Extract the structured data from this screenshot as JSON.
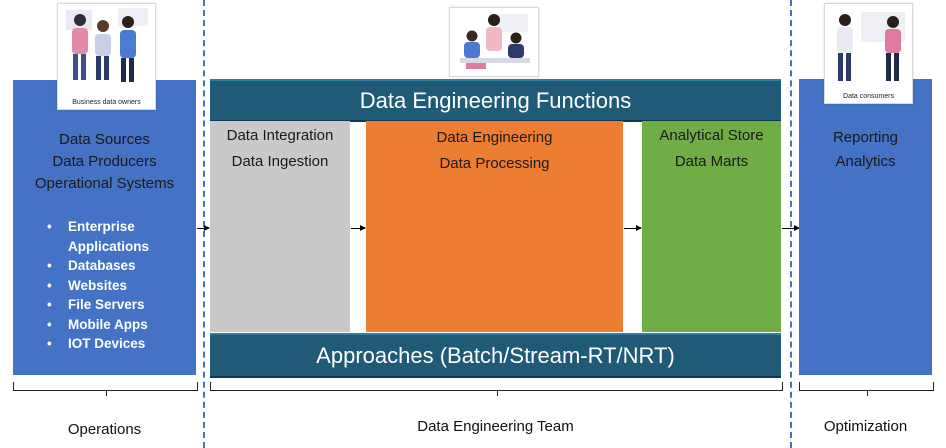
{
  "left_panel": {
    "titles": [
      "Data Sources",
      "Data Producers",
      "Operational Systems"
    ],
    "items": [
      [
        "Enterprise",
        "Applications"
      ],
      [
        "Databases"
      ],
      [
        "Websites"
      ],
      [
        "File Servers"
      ],
      [
        "Mobile Apps"
      ],
      [
        "IOT Devices"
      ]
    ]
  },
  "images": {
    "left_caption": "Business data owners",
    "right_caption": "Data consumers"
  },
  "center": {
    "header": "Data Engineering Functions",
    "footer": "Approaches (Batch/Stream-RT/NRT)",
    "stages": [
      {
        "line1": "Data Integration",
        "line2": "Data Ingestion",
        "color": "#c9c9c9"
      },
      {
        "line1": "Data Engineering",
        "line2": "Data Processing",
        "color": "#ed7d31"
      },
      {
        "line1": "Analytical Store",
        "line2": "Data Marts",
        "color": "#70ad47"
      }
    ]
  },
  "right_panel": {
    "titles": [
      "Reporting",
      "Analytics"
    ]
  },
  "footers": {
    "left": "Operations",
    "center": "Data Engineering Team",
    "right": "Optimization"
  },
  "colors": {
    "panel_blue": "#4472c4",
    "banner_teal": "#1f5a76",
    "divider_dash": "#4472c4"
  }
}
